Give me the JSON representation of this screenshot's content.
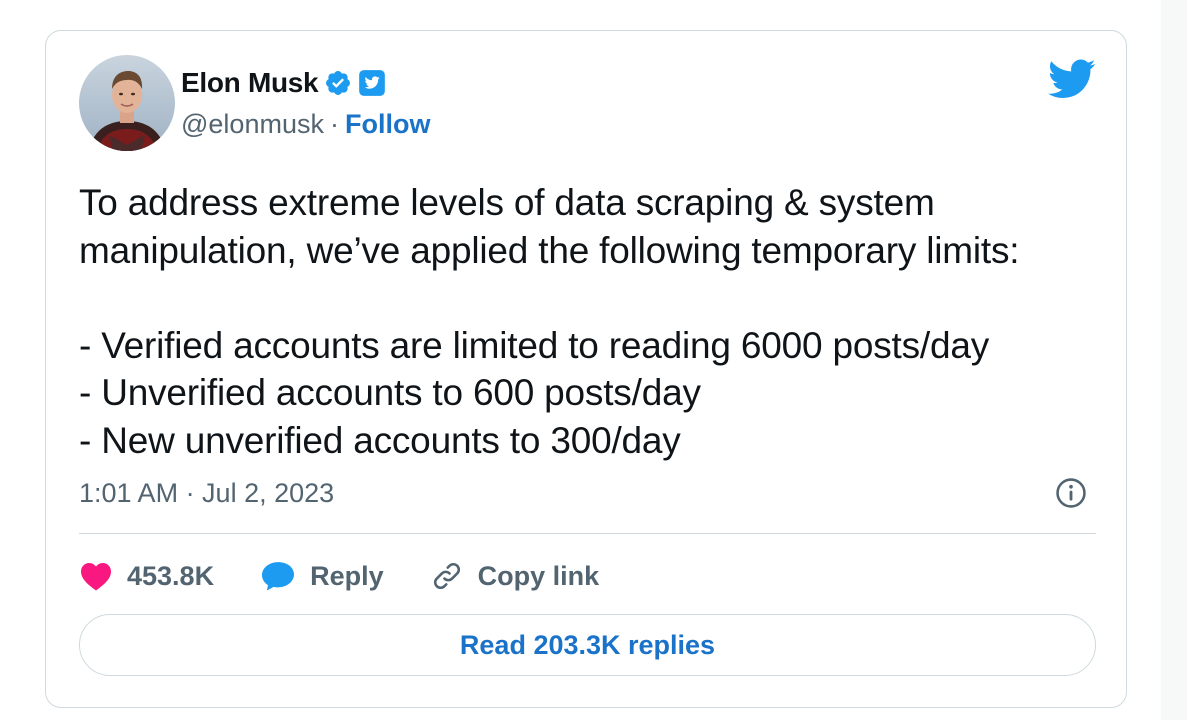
{
  "author": {
    "display_name": "Elon Musk",
    "handle": "@elonmusk",
    "separator": "·",
    "follow_label": "Follow",
    "verified_badge_icon": "verified-badge-icon",
    "twitter_small_icon": "twitter-square-icon"
  },
  "brand": {
    "icon": "twitter-bird-icon",
    "color": "#1d9bf0"
  },
  "tweet": {
    "lines": [
      "To address extreme levels of data scraping & system",
      "manipulation, we’ve applied the following temporary limits:",
      "",
      "- Verified accounts are limited to reading 6000 posts/day",
      "- Unverified accounts to 600 posts/day",
      "- New unverified accounts to 300/day"
    ],
    "timestamp": "1:01 AM · Jul 2, 2023"
  },
  "actions": {
    "like_count": "453.8K",
    "like_icon": "heart-icon",
    "like_color": "#f91880",
    "reply_label": "Reply",
    "reply_icon": "speech-bubble-icon",
    "reply_color": "#1d9bf0",
    "copy_label": "Copy link",
    "copy_icon": "link-icon"
  },
  "read_replies_label": "Read 203.3K replies",
  "colors": {
    "text": "#0f1419",
    "secondary": "#536471",
    "link": "#1a73c8",
    "border": "#cfd9de"
  }
}
